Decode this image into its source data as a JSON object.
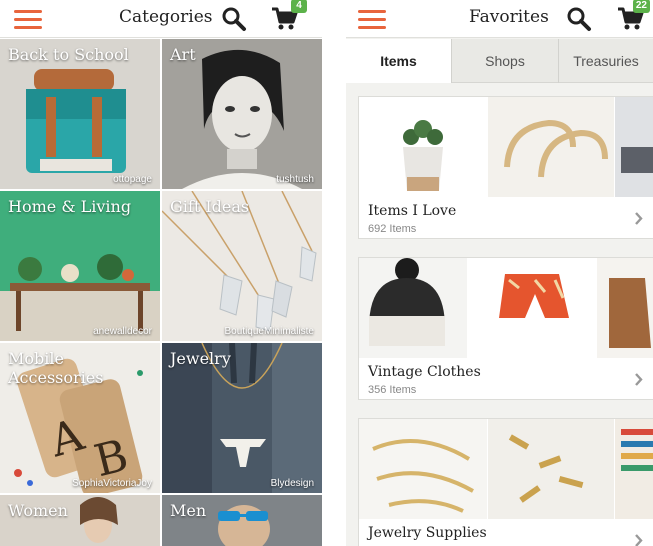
{
  "colors": {
    "accent": "#e8643c",
    "badge": "#5cb24a"
  },
  "left_screen": {
    "title": "Categories",
    "cart_count": "4",
    "icons": [
      "menu-icon",
      "search-icon",
      "cart-icon"
    ],
    "categories": [
      {
        "label": "Back to School",
        "credit": "ottopage"
      },
      {
        "label": "Art",
        "credit": "tushtush"
      },
      {
        "label": "Home & Living",
        "credit": "anewalldecor"
      },
      {
        "label": "Gift Ideas",
        "credit": "BoutiqueMinimaliste"
      },
      {
        "label": "Mobile Accessories",
        "credit": "SophiaVictoriaJoy"
      },
      {
        "label": "Jewelry",
        "credit": "Blydesign"
      },
      {
        "label": "Women",
        "credit": ""
      },
      {
        "label": "Men",
        "credit": ""
      }
    ]
  },
  "right_screen": {
    "title": "Favorites",
    "cart_count": "22",
    "icons": [
      "menu-icon",
      "search-icon",
      "cart-icon",
      "chevron-right-icon"
    ],
    "tabs": [
      "Items",
      "Shops",
      "Treasuries"
    ],
    "active_tab": "Items",
    "lists": [
      {
        "title": "Items I Love",
        "count": "692 Items"
      },
      {
        "title": "Vintage Clothes",
        "count": "356 Items"
      },
      {
        "title": "Jewelry Supplies",
        "count": ""
      }
    ]
  }
}
